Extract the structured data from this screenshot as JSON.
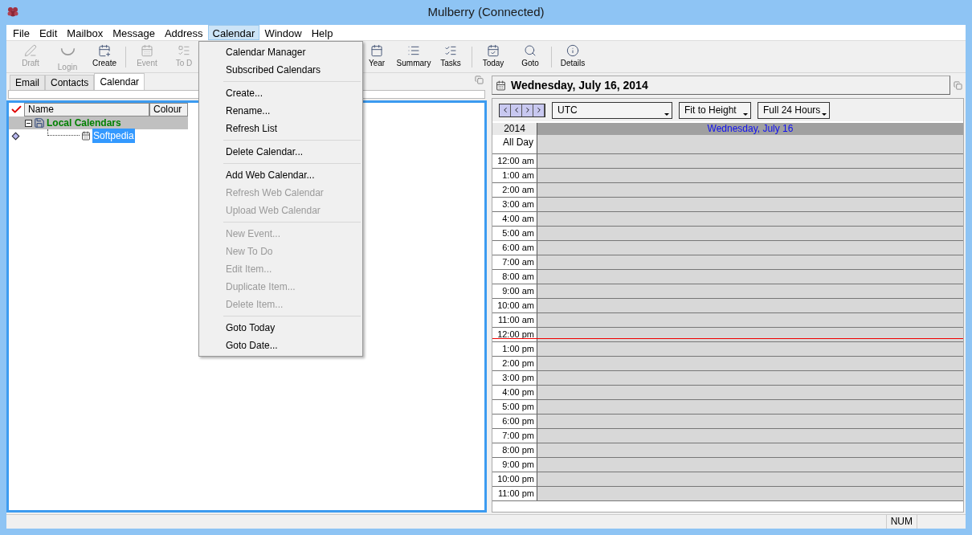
{
  "window": {
    "title": "Mulberry (Connected)"
  },
  "menu_bar": [
    {
      "label": "File",
      "selected": false
    },
    {
      "label": "Edit",
      "selected": false
    },
    {
      "label": "Mailbox",
      "selected": false
    },
    {
      "label": "Message",
      "selected": false
    },
    {
      "label": "Address",
      "selected": false
    },
    {
      "label": "Calendar",
      "selected": true
    },
    {
      "label": "Window",
      "selected": false
    },
    {
      "label": "Help",
      "selected": false
    }
  ],
  "toolbar": [
    {
      "label": "Draft",
      "disabled": true
    },
    {
      "label": "Login",
      "disabled": true
    },
    {
      "label": "Create",
      "disabled": false
    },
    {
      "label": "Event",
      "disabled": true
    },
    {
      "label": "To D",
      "disabled": true
    },
    {
      "label": "Year",
      "disabled": false
    },
    {
      "label": "Summary",
      "disabled": false
    },
    {
      "label": "Tasks",
      "disabled": false
    },
    {
      "label": "Today",
      "disabled": false
    },
    {
      "label": "Goto",
      "disabled": false
    },
    {
      "label": "Details",
      "disabled": false
    }
  ],
  "left_tabs": [
    {
      "label": "Email",
      "selected": false
    },
    {
      "label": "Contacts",
      "selected": false
    },
    {
      "label": "Calendar",
      "selected": true
    }
  ],
  "calendar_tree": {
    "columns": [
      "Name",
      "Colour"
    ],
    "items": [
      {
        "name": "Local Calendars",
        "expanded": true,
        "children": [
          {
            "name": "Softpedia",
            "selected": true
          }
        ]
      }
    ]
  },
  "calendar_menu": [
    [
      {
        "label": "Calendar Manager",
        "disabled": false
      },
      {
        "label": "Subscribed Calendars",
        "disabled": false
      }
    ],
    [
      {
        "label": "Create...",
        "disabled": false
      },
      {
        "label": "Rename...",
        "disabled": false
      },
      {
        "label": "Refresh List",
        "disabled": false
      }
    ],
    [
      {
        "label": "Delete Calendar...",
        "disabled": false
      }
    ],
    [
      {
        "label": "Add Web Calendar...",
        "disabled": false
      },
      {
        "label": "Refresh Web Calendar",
        "disabled": true
      },
      {
        "label": "Upload Web Calendar",
        "disabled": true
      }
    ],
    [
      {
        "label": "New Event...",
        "disabled": true
      },
      {
        "label": "New To Do",
        "disabled": true
      },
      {
        "label": "Edit Item...",
        "disabled": true
      },
      {
        "label": "Duplicate Item...",
        "disabled": true
      },
      {
        "label": "Delete Item...",
        "disabled": true
      }
    ],
    [
      {
        "label": "Goto Today",
        "disabled": false
      },
      {
        "label": "Goto Date...",
        "disabled": false
      }
    ]
  ],
  "day_view": {
    "title": "Wednesday, July 16, 2014",
    "timezone": "UTC",
    "zoom": "Fit to Height",
    "range": "Full 24 Hours",
    "year": "2014",
    "column": "Wednesday, July 16",
    "all_day": "All Day",
    "hours": [
      "12:00 am",
      "1:00 am",
      "2:00 am",
      "3:00 am",
      "4:00 am",
      "5:00 am",
      "6:00 am",
      "7:00 am",
      "8:00 am",
      "9:00 am",
      "10:00 am",
      "11:00 am",
      "12:00 pm",
      "1:00 pm",
      "2:00 pm",
      "3:00 pm",
      "4:00 pm",
      "5:00 pm",
      "6:00 pm",
      "7:00 pm",
      "8:00 pm",
      "9:00 pm",
      "10:00 pm",
      "11:00 pm"
    ]
  },
  "status_bar": {
    "num": "NUM"
  }
}
